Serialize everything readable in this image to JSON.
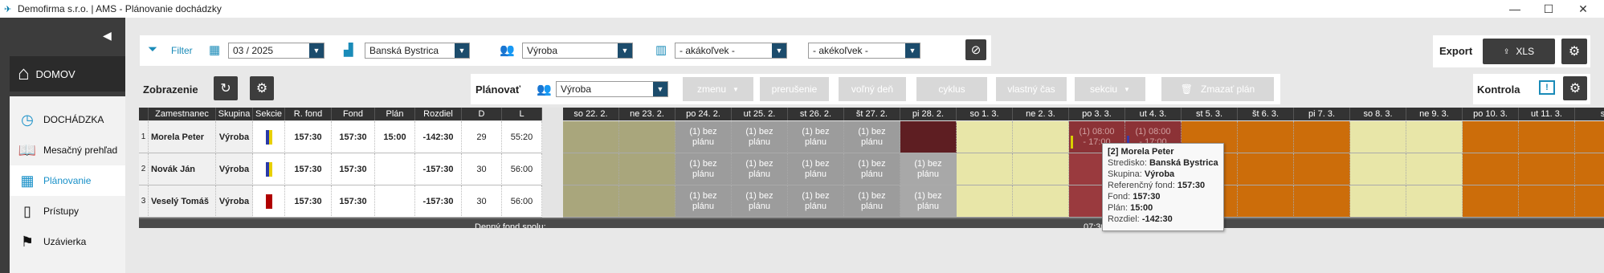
{
  "window": {
    "title": "Demofirma s.r.o. | AMS - Plánovanie dochádzky"
  },
  "sidebar": {
    "home": "DOMOV",
    "items": [
      {
        "label": "DOCHÁDZKA",
        "icon": "clock-icon"
      },
      {
        "label": "Mesačný prehľad",
        "icon": "book-icon"
      },
      {
        "label": "Plánovanie",
        "icon": "calendar-icon"
      },
      {
        "label": "Prístupy",
        "icon": "door-icon"
      },
      {
        "label": "Uzávierka",
        "icon": "checkered-flag-icon"
      }
    ]
  },
  "filter": {
    "label": "Filter",
    "period": "03 / 2025",
    "location": "Banská Bystrica",
    "group": "Výroba",
    "col1": "- akákoľvek -",
    "col2": "- akékoľvek -"
  },
  "export": {
    "label": "Export",
    "xls": "XLS"
  },
  "toolbar": {
    "zobrazenie": "Zobrazenie",
    "planovat": "Plánovať",
    "plan_group": "Výroba",
    "kontrola": "Kontrola",
    "buttons": [
      "zmenu",
      "prerušenie",
      "voľný deň",
      "cyklus",
      "vlastný čas",
      "sekciu"
    ],
    "delete_plan": "Zmazať plán"
  },
  "table": {
    "columns": [
      "Zamestnanec",
      "Skupina",
      "Sekcie",
      "R. fond",
      "Fond",
      "Plán",
      "Rozdiel",
      "D",
      "L"
    ],
    "days": [
      "so 22. 2.",
      "ne 23. 2.",
      "po 24. 2.",
      "ut 25. 2.",
      "st 26. 2.",
      "št 27. 2.",
      "pi 28. 2.",
      "so 1. 3.",
      "ne 2. 3.",
      "po 3. 3.",
      "ut 4. 3.",
      "st 5. 3.",
      "št 6. 3.",
      "pi 7. 3.",
      "so 8. 3.",
      "ne 9. 3.",
      "po 10. 3.",
      "ut 11. 3.",
      "s"
    ],
    "rows": [
      {
        "num": "1",
        "name": "Morela Peter",
        "group": "Výroba",
        "rfond": "157:30",
        "fond": "157:30",
        "plan": "15:00",
        "diff": "-142:30",
        "d": "29",
        "l": "55:20"
      },
      {
        "num": "2",
        "name": "Novák Ján",
        "group": "Výroba",
        "rfond": "157:30",
        "fond": "157:30",
        "plan": "",
        "diff": "-157:30",
        "d": "30",
        "l": "56:00"
      },
      {
        "num": "3",
        "name": "Veselý Tomáš",
        "group": "Výroba",
        "rfond": "157:30",
        "fond": "157:30",
        "plan": "",
        "diff": "-157:30",
        "d": "30",
        "l": "56:00"
      }
    ],
    "bez_planu": "(1) bez plánu",
    "shift_start": "(1) 08:00",
    "shift_end": "- 17:00",
    "footer_label": "Denný fond spolu:",
    "footer_value": "07:30"
  },
  "tooltip": {
    "title": "[2] Morela Peter",
    "lines": [
      [
        "Stredisko:",
        "Banská Bystrica"
      ],
      [
        "Skupina:",
        "Výroba"
      ],
      [
        "Referenčný fond:",
        "157:30"
      ],
      [
        "Fond:",
        "157:30"
      ],
      [
        "Plán:",
        "15:00"
      ],
      [
        "Rozdiel:",
        "-142:30"
      ]
    ]
  }
}
